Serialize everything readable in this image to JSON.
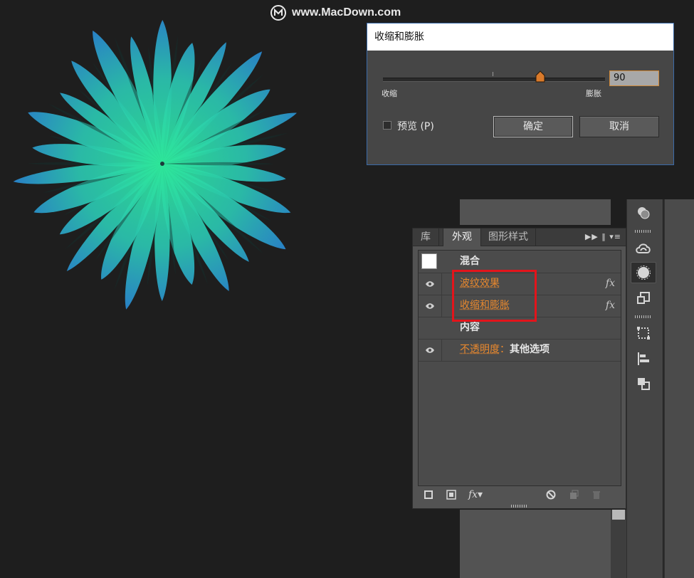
{
  "watermark": {
    "text": "www.MacDown.com",
    "icon": "macdown-logo-icon"
  },
  "dialog": {
    "title": "收缩和膨胀",
    "slider": {
      "left_label": "收缩",
      "right_label": "膨胀",
      "value": "90",
      "level_fraction": 0.72
    },
    "preview_label": "预览 (P)",
    "preview_checked": false,
    "ok_label": "确定",
    "cancel_label": "取消"
  },
  "panel": {
    "tabs": [
      "库",
      "外观",
      "图形样式"
    ],
    "active_tab": "外观",
    "menu_icon": "panel-menu-icon",
    "rows": {
      "blend": "混合",
      "effect1": "波纹效果",
      "effect2": "收缩和膨胀",
      "content": "内容",
      "opacity_label": "不透明度",
      "opacity_sep": "：",
      "opacity_value": "其他选项"
    },
    "fx_label": "fx"
  },
  "colors": {
    "highlight": "#e3141b",
    "link": "#e8882e",
    "flower_center": "#2ee89a",
    "flower_edge": "#2a86d6"
  }
}
